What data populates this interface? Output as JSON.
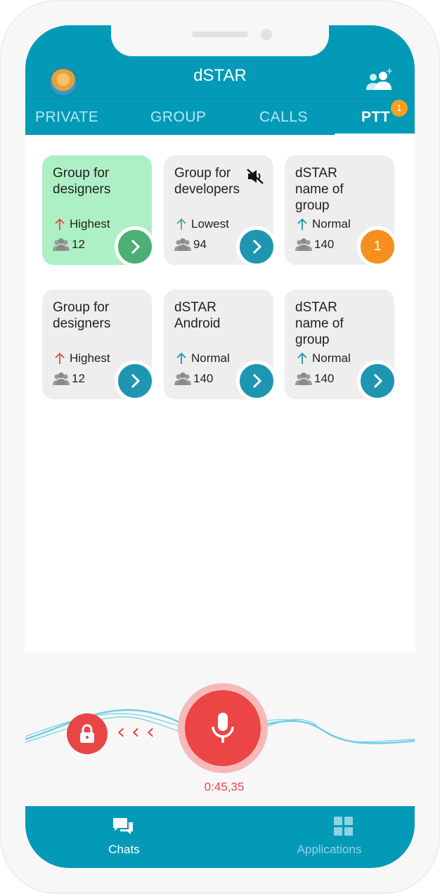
{
  "app": {
    "title": "dSTAR"
  },
  "tabs": [
    {
      "label": "PRIVATE"
    },
    {
      "label": "GROUP"
    },
    {
      "label": "CALLS"
    },
    {
      "label": "PTT",
      "badge": "1"
    }
  ],
  "cards": [
    {
      "name": "Group for\ndesigners",
      "priority": "Highest",
      "members": "12",
      "action": "chevron-right",
      "style": "green"
    },
    {
      "name": "Group for\ndevelopers",
      "priority": "Lowest",
      "members": "94",
      "action": "chevron-right",
      "muted": true
    },
    {
      "name": "dSTAR\nname of\ngroup",
      "priority": "Normal",
      "members": "140",
      "action_badge": "1"
    },
    {
      "name": "Group for\ndesigners",
      "priority": "Highest",
      "members": "12",
      "action": "chevron-right"
    },
    {
      "name": "dSTAR\nAndroid",
      "priority": "Normal",
      "members": "140",
      "action": "chevron-right"
    },
    {
      "name": "dSTAR\nname of\ngroup",
      "priority": "Normal",
      "members": "140",
      "action": "chevron-right"
    }
  ],
  "recording": {
    "timer": "0:45,35"
  },
  "bottom_nav": [
    {
      "label": "Chats",
      "icon": "chat-bubbles-icon"
    },
    {
      "label": "Applications",
      "icon": "grid-icon"
    }
  ],
  "colors": {
    "primary": "#039ab8",
    "active_card": "#adf0c5",
    "record_red": "#ec4545",
    "badge_orange": "#f5901e",
    "priority_highest": "#e84848",
    "priority_lowest": "#4caf73",
    "priority_normal": "#1e96b2"
  }
}
